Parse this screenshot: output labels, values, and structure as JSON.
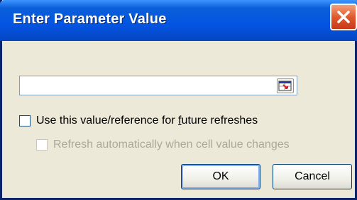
{
  "dialog": {
    "title": "Enter Parameter Value",
    "close_icon": "close-icon",
    "reference_input": {
      "value": "",
      "collapse_icon": "collapse-dialog-icon"
    },
    "checkbox_future": {
      "label_before": "Use this value/reference for ",
      "label_accel": "f",
      "label_after": "uture refreshes",
      "checked": false
    },
    "checkbox_auto": {
      "label": "Refresh automatically when cell value changes",
      "checked": false,
      "disabled": true
    },
    "ok_label": "OK",
    "cancel_label": "Cancel"
  },
  "colors": {
    "titlebar": "#0454E2",
    "window_bg": "#ECE9D8",
    "close": "#E0592C"
  }
}
